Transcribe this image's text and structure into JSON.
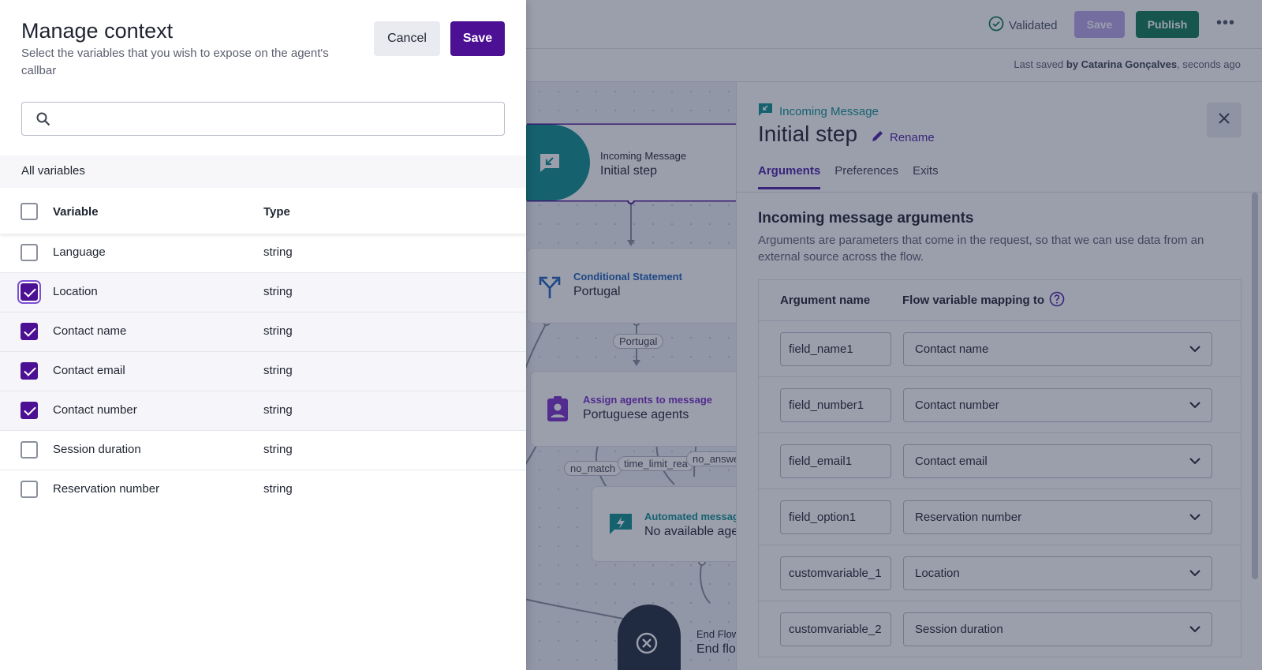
{
  "topbar": {
    "validated_label": "Validated",
    "save_label": "Save",
    "publish_label": "Publish",
    "more_label": "•••"
  },
  "savedbar": {
    "prefix": "Last saved ",
    "by_text": "by Catarina Gonçalves",
    "suffix": ", seconds ago"
  },
  "canvas": {
    "nodes": [
      {
        "type": "Incoming Message",
        "name": "Initial step"
      },
      {
        "type": "Conditional Statement",
        "name": "Portugal"
      },
      {
        "type": "Assign agents to message",
        "name": "Portuguese agents"
      },
      {
        "type": "Automated messag",
        "name": "No available agen"
      },
      {
        "type": "End Flow",
        "name": "End flow"
      }
    ],
    "edge_labels": [
      "Portugal",
      "no_match",
      "time_limit_rea",
      "no_answe"
    ]
  },
  "panel": {
    "kind": "Incoming Message",
    "title": "Initial step",
    "rename_label": "Rename",
    "tabs": [
      "Arguments",
      "Preferences",
      "Exits"
    ],
    "active_tab": "Arguments",
    "section_title": "Incoming message arguments",
    "section_desc": "Arguments are parameters that come in the request, so that we can use data from an external source across the flow.",
    "col_argument": "Argument name",
    "col_mapping": "Flow variable mapping to",
    "arguments": [
      {
        "name": "field_name1",
        "mapping": "Contact name"
      },
      {
        "name": "field_number1",
        "mapping": "Contact number"
      },
      {
        "name": "field_email1",
        "mapping": "Contact email"
      },
      {
        "name": "field_option1",
        "mapping": "Reservation number"
      },
      {
        "name": "customvariable_1",
        "mapping": "Location"
      },
      {
        "name": "customvariable_2",
        "mapping": "Session duration"
      }
    ]
  },
  "drawer": {
    "title": "Manage context",
    "subtitle": "Select the variables that you wish to expose on the agent's callbar",
    "cancel_label": "Cancel",
    "save_label": "Save",
    "search_placeholder": "",
    "search_value": "",
    "group_label": "All variables",
    "col_variable": "Variable",
    "col_type": "Type",
    "variables": [
      {
        "name": "Language",
        "type": "string",
        "checked": false
      },
      {
        "name": "Location",
        "type": "string",
        "checked": true
      },
      {
        "name": "Contact name",
        "type": "string",
        "checked": true
      },
      {
        "name": "Contact email",
        "type": "string",
        "checked": true
      },
      {
        "name": "Contact number",
        "type": "string",
        "checked": true
      },
      {
        "name": "Session duration",
        "type": "string",
        "checked": false
      },
      {
        "name": "Reservation number",
        "type": "string",
        "checked": false
      }
    ]
  },
  "colors": {
    "primary": "#4b1093",
    "publish": "#0e7a55",
    "teal": "#0b8f8f",
    "conditional": "#1d5fb8",
    "assign": "#7a2fc9",
    "end": "#1f2d3d"
  }
}
